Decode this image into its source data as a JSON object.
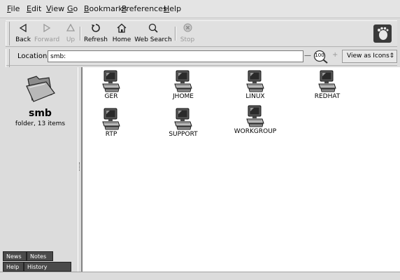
{
  "menubar": {
    "items": [
      {
        "label": "File",
        "underline": "F",
        "rest": "ile"
      },
      {
        "label": "Edit",
        "underline": "E",
        "rest": "dit"
      },
      {
        "label": "View",
        "underline": "V",
        "rest": "iew"
      },
      {
        "label": "Go",
        "underline": "G",
        "rest": "o"
      },
      {
        "label": "Bookmarks",
        "underline": "B",
        "rest": "ookmarks"
      },
      {
        "label": "Preferences",
        "underline": "P",
        "rest": "references"
      },
      {
        "label": "Help",
        "underline": "H",
        "rest": "elp"
      }
    ]
  },
  "toolbar": {
    "back": {
      "label": "Back",
      "icon": "back-arrow-icon"
    },
    "forward": {
      "label": "Forward",
      "icon": "forward-arrow-icon"
    },
    "up": {
      "label": "Up",
      "icon": "up-arrow-icon"
    },
    "refresh": {
      "label": "Refresh",
      "icon": "refresh-icon"
    },
    "home": {
      "label": "Home",
      "icon": "home-icon"
    },
    "web_search": {
      "label": "Web Search",
      "icon": "search-icon"
    },
    "stop": {
      "label": "Stop",
      "icon": "stop-icon"
    }
  },
  "location": {
    "label": "Location:",
    "value": "smb:",
    "zoom": "100",
    "view_mode": "View as Icons"
  },
  "sidebar": {
    "title": "smb",
    "info": "folder, 13 items",
    "tabs": {
      "news": "News",
      "notes": "Notes",
      "help": "Help",
      "history": "History"
    }
  },
  "items": [
    {
      "name": "GER"
    },
    {
      "name": "JHOME"
    },
    {
      "name": "LINUX"
    },
    {
      "name": "REDHAT"
    },
    {
      "name": "RTP"
    },
    {
      "name": "SUPPORT"
    },
    {
      "name": "WORKGROUP"
    }
  ],
  "colors": {
    "background": "#dcdcdc",
    "main_view": "#ffffff",
    "tab_dark": "#4a4a4a"
  }
}
